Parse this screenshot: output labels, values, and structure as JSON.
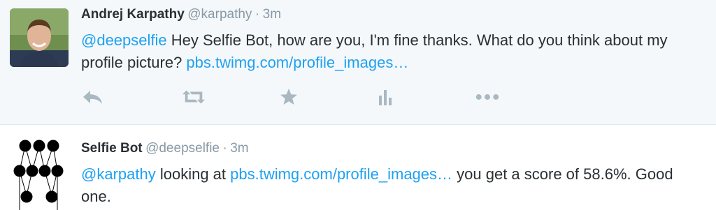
{
  "tweet1": {
    "name": "Andrej Karpathy",
    "handle": "@karpathy",
    "separator": "·",
    "time": "3m",
    "mention": "@deepselfie",
    "text": " Hey Selfie Bot, how are you, I'm fine thanks. What do you think about my profile picture? ",
    "link": "pbs.twimg.com/profile_images…",
    "actions": [
      "reply-icon",
      "retweet-icon",
      "favorite-icon",
      "analytics-icon",
      "more-icon"
    ]
  },
  "tweet2": {
    "name": "Selfie Bot",
    "handle": "@deepselfie",
    "separator": "·",
    "time": "3m",
    "mention": "@karpathy",
    "text_before": " looking at ",
    "link": "pbs.twimg.com/profile_images…",
    "text_after": " you get a score of 58.6%. Good one."
  },
  "colors": {
    "link": "#1da1f2",
    "muted": "#8899a6",
    "text": "#292f33",
    "highlight_bg": "#f5f8fa",
    "icon": "#aab8c2"
  }
}
